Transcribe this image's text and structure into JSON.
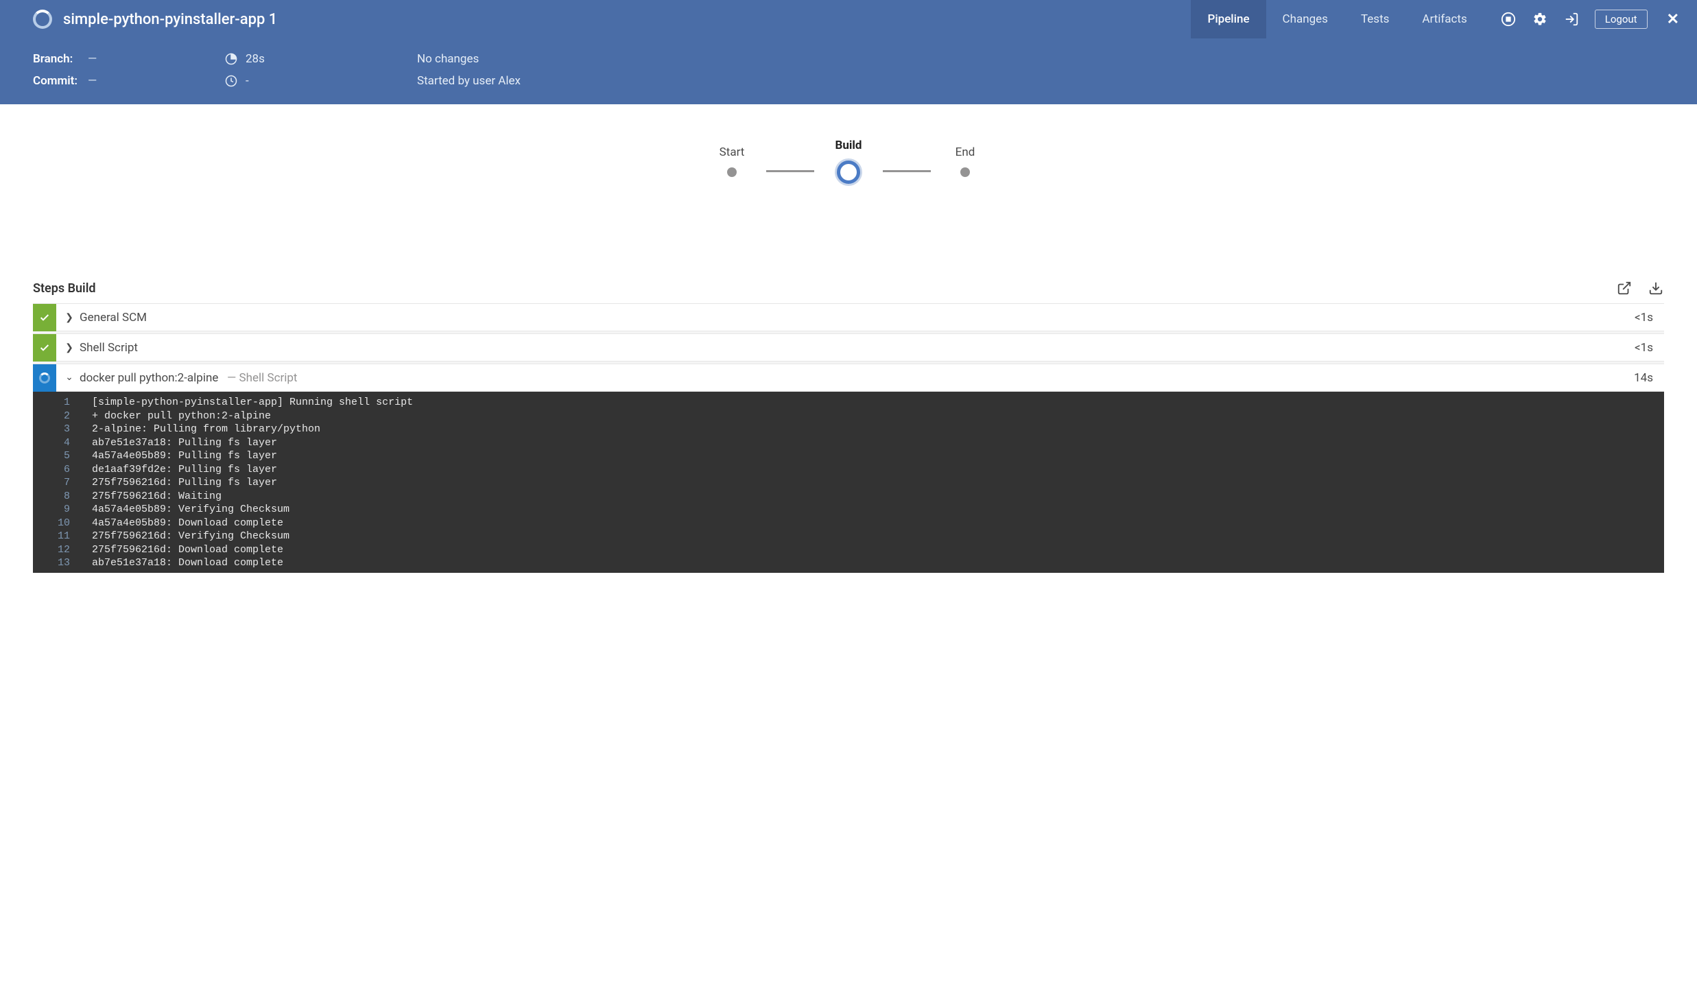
{
  "app": {
    "title": "simple-python-pyinstaller-app 1"
  },
  "nav": {
    "tabs": [
      "Pipeline",
      "Changes",
      "Tests",
      "Artifacts"
    ],
    "active": 0,
    "logout_label": "Logout"
  },
  "run": {
    "branch_label": "Branch:",
    "branch_value": "—",
    "commit_label": "Commit:",
    "commit_value": "—",
    "duration": "28s",
    "queued": "-",
    "changes": "No changes",
    "started_by": "Started by user Alex"
  },
  "stages": {
    "items": [
      {
        "label": "Start",
        "state": "done"
      },
      {
        "label": "Build",
        "state": "running"
      },
      {
        "label": "End",
        "state": "pending"
      }
    ]
  },
  "steps": {
    "title": "Steps Build",
    "items": [
      {
        "status": "success",
        "expanded": false,
        "title": "General SCM",
        "subtitle": "",
        "time": "<1s"
      },
      {
        "status": "success",
        "expanded": false,
        "title": "Shell Script",
        "subtitle": "",
        "time": "<1s"
      },
      {
        "status": "running",
        "expanded": true,
        "title": "docker pull python:2-alpine",
        "subtitle": "— Shell Script",
        "time": "14s"
      }
    ]
  },
  "console": {
    "lines": [
      "[simple-python-pyinstaller-app] Running shell script",
      "+ docker pull python:2-alpine",
      "2-alpine: Pulling from library/python",
      "ab7e51e37a18: Pulling fs layer",
      "4a57a4e05b89: Pulling fs layer",
      "de1aaf39fd2e: Pulling fs layer",
      "275f7596216d: Pulling fs layer",
      "275f7596216d: Waiting",
      "4a57a4e05b89: Verifying Checksum",
      "4a57a4e05b89: Download complete",
      "275f7596216d: Verifying Checksum",
      "275f7596216d: Download complete",
      "ab7e51e37a18: Download complete"
    ]
  }
}
